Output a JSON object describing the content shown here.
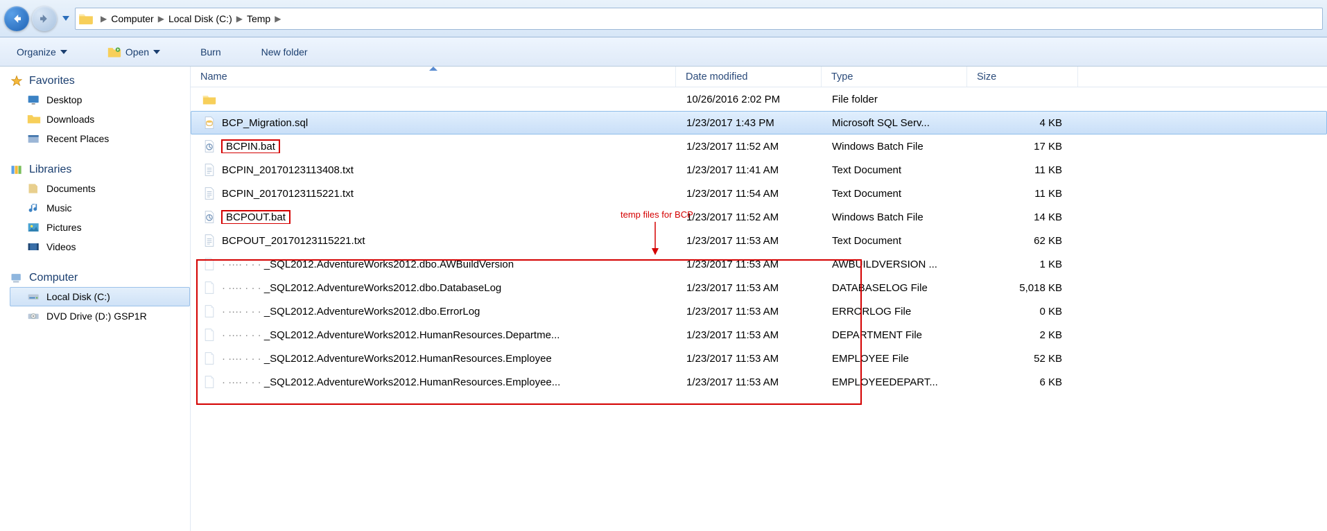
{
  "breadcrumb": {
    "items": [
      "Computer",
      "Local Disk (C:)",
      "Temp"
    ]
  },
  "toolbar": {
    "organize": "Organize",
    "open": "Open",
    "burn": "Burn",
    "newfolder": "New folder"
  },
  "nav": {
    "favorites": {
      "label": "Favorites",
      "items": [
        "Desktop",
        "Downloads",
        "Recent Places"
      ]
    },
    "libraries": {
      "label": "Libraries",
      "items": [
        "Documents",
        "Music",
        "Pictures",
        "Videos"
      ]
    },
    "computer": {
      "label": "Computer",
      "items": [
        "Local Disk (C:)",
        "DVD Drive (D:) GSP1R"
      ]
    }
  },
  "columns": {
    "name": "Name",
    "date": "Date modified",
    "type": "Type",
    "size": "Size"
  },
  "files": [
    {
      "icon": "folder",
      "name": "",
      "pre": "",
      "date": "10/26/2016 2:02 PM",
      "type": "File folder",
      "size": ""
    },
    {
      "icon": "sql",
      "name": "BCP_Migration.sql",
      "pre": "",
      "date": "1/23/2017 1:43 PM",
      "type": "Microsoft SQL Serv...",
      "size": "4 KB",
      "selected": true
    },
    {
      "icon": "bat",
      "name": "BCPIN.bat",
      "pre": "",
      "date": "1/23/2017 11:52 AM",
      "type": "Windows Batch File",
      "size": "17 KB",
      "red": true
    },
    {
      "icon": "txt",
      "name": "BCPIN_20170123113408.txt",
      "pre": "",
      "date": "1/23/2017 11:41 AM",
      "type": "Text Document",
      "size": "11 KB"
    },
    {
      "icon": "txt",
      "name": "BCPIN_20170123115221.txt",
      "pre": "",
      "date": "1/23/2017 11:54 AM",
      "type": "Text Document",
      "size": "11 KB"
    },
    {
      "icon": "bat",
      "name": "BCPOUT.bat",
      "pre": "",
      "date": "1/23/2017 11:52 AM",
      "type": "Windows Batch File",
      "size": "14 KB",
      "red": true
    },
    {
      "icon": "txt",
      "name": "BCPOUT_20170123115221.txt",
      "pre": "",
      "date": "1/23/2017 11:53 AM",
      "type": "Text Document",
      "size": "62 KB"
    },
    {
      "icon": "blank",
      "name": "_SQL2012.AdventureWorks2012.dbo.AWBuildVersion",
      "pre": "· ···· · · · ",
      "date": "1/23/2017 11:53 AM",
      "type": "AWBUILDVERSION ...",
      "size": "1 KB"
    },
    {
      "icon": "blank",
      "name": "_SQL2012.AdventureWorks2012.dbo.DatabaseLog",
      "pre": "· ···· · · · ",
      "date": "1/23/2017 11:53 AM",
      "type": "DATABASELOG File",
      "size": "5,018 KB"
    },
    {
      "icon": "blank",
      "name": "_SQL2012.AdventureWorks2012.dbo.ErrorLog",
      "pre": "· ···· · · · ",
      "date": "1/23/2017 11:53 AM",
      "type": "ERRORLOG File",
      "size": "0 KB"
    },
    {
      "icon": "blank",
      "name": "_SQL2012.AdventureWorks2012.HumanResources.Departme...",
      "pre": "· ···· · · · ",
      "date": "1/23/2017 11:53 AM",
      "type": "DEPARTMENT File",
      "size": "2 KB"
    },
    {
      "icon": "blank",
      "name": "_SQL2012.AdventureWorks2012.HumanResources.Employee",
      "pre": "· ···· · · · ",
      "date": "1/23/2017 11:53 AM",
      "type": "EMPLOYEE File",
      "size": "52 KB"
    },
    {
      "icon": "blank",
      "name": "_SQL2012.AdventureWorks2012.HumanResources.Employee...",
      "pre": "· ···· · · · ",
      "date": "1/23/2017 11:53 AM",
      "type": "EMPLOYEEDEPART...",
      "size": "6 KB"
    }
  ],
  "annotation": {
    "label": "temp files for BCP"
  }
}
